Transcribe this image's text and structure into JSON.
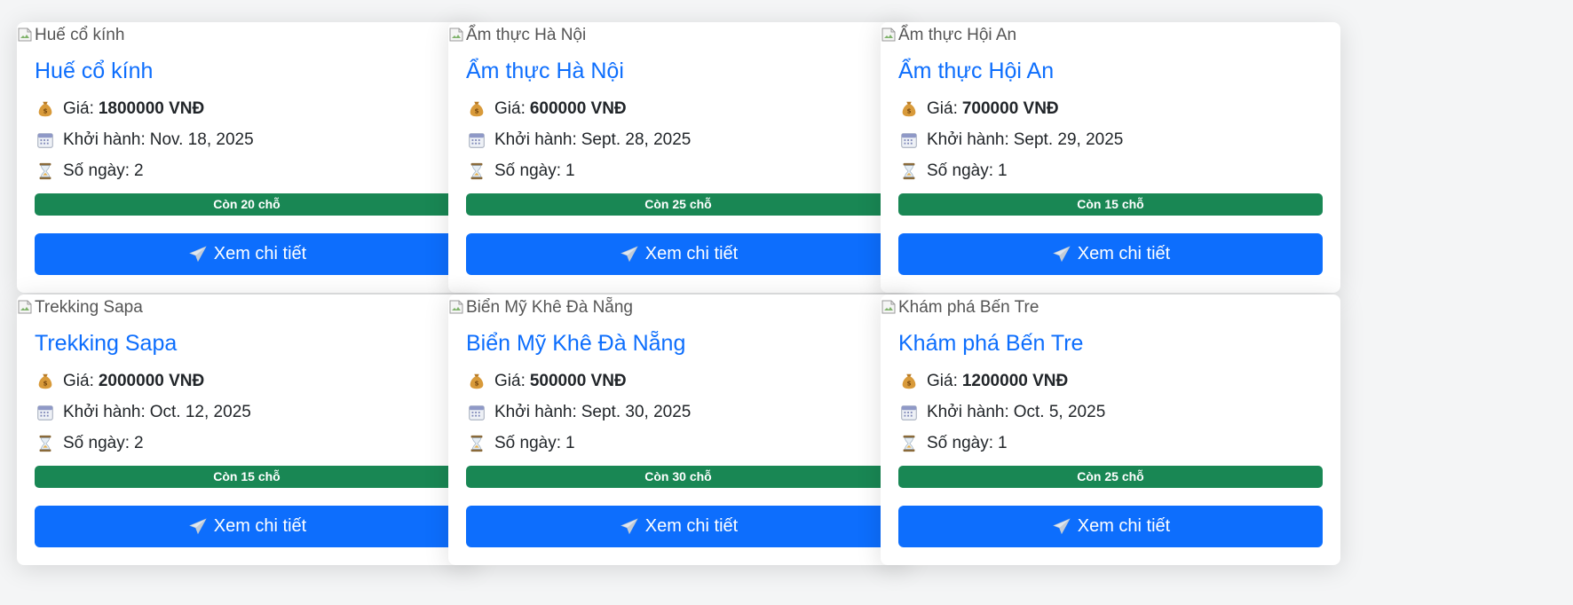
{
  "labels": {
    "price": "Giá:",
    "departure": "Khởi hành:",
    "days": "Số ngày:",
    "detail_button": "Xem chi tiết"
  },
  "icons": {
    "price": "money-bag-icon",
    "departure": "calendar-icon",
    "days": "hourglass-icon",
    "button": "airplane-icon",
    "image": "broken-image-icon"
  },
  "colors": {
    "title": "#0d6efd",
    "badge": "#198754",
    "button": "#0d6efd"
  },
  "tours": [
    {
      "image_alt": "Huế cổ kính",
      "title": "Huế cổ kính",
      "price": "1800000 VNĐ",
      "departure": "Nov. 18, 2025",
      "days": "2",
      "seats": "Còn 20 chỗ"
    },
    {
      "image_alt": "Ẩm thực Hà Nội",
      "title": "Ẩm thực Hà Nội",
      "price": "600000 VNĐ",
      "departure": "Sept. 28, 2025",
      "days": "1",
      "seats": "Còn 25 chỗ"
    },
    {
      "image_alt": "Ẩm thực Hội An",
      "title": "Ẩm thực Hội An",
      "price": "700000 VNĐ",
      "departure": "Sept. 29, 2025",
      "days": "1",
      "seats": "Còn 15 chỗ"
    },
    {
      "image_alt": "Trekking Sapa",
      "title": "Trekking Sapa",
      "price": "2000000 VNĐ",
      "departure": "Oct. 12, 2025",
      "days": "2",
      "seats": "Còn 15 chỗ"
    },
    {
      "image_alt": "Biển Mỹ Khê Đà Nẵng",
      "title": "Biển Mỹ Khê Đà Nẵng",
      "price": "500000 VNĐ",
      "departure": "Sept. 30, 2025",
      "days": "1",
      "seats": "Còn 30 chỗ"
    },
    {
      "image_alt": "Khám phá Bến Tre",
      "title": "Khám phá Bến Tre",
      "price": "1200000 VNĐ",
      "departure": "Oct. 5, 2025",
      "days": "1",
      "seats": "Còn 25 chỗ"
    }
  ]
}
